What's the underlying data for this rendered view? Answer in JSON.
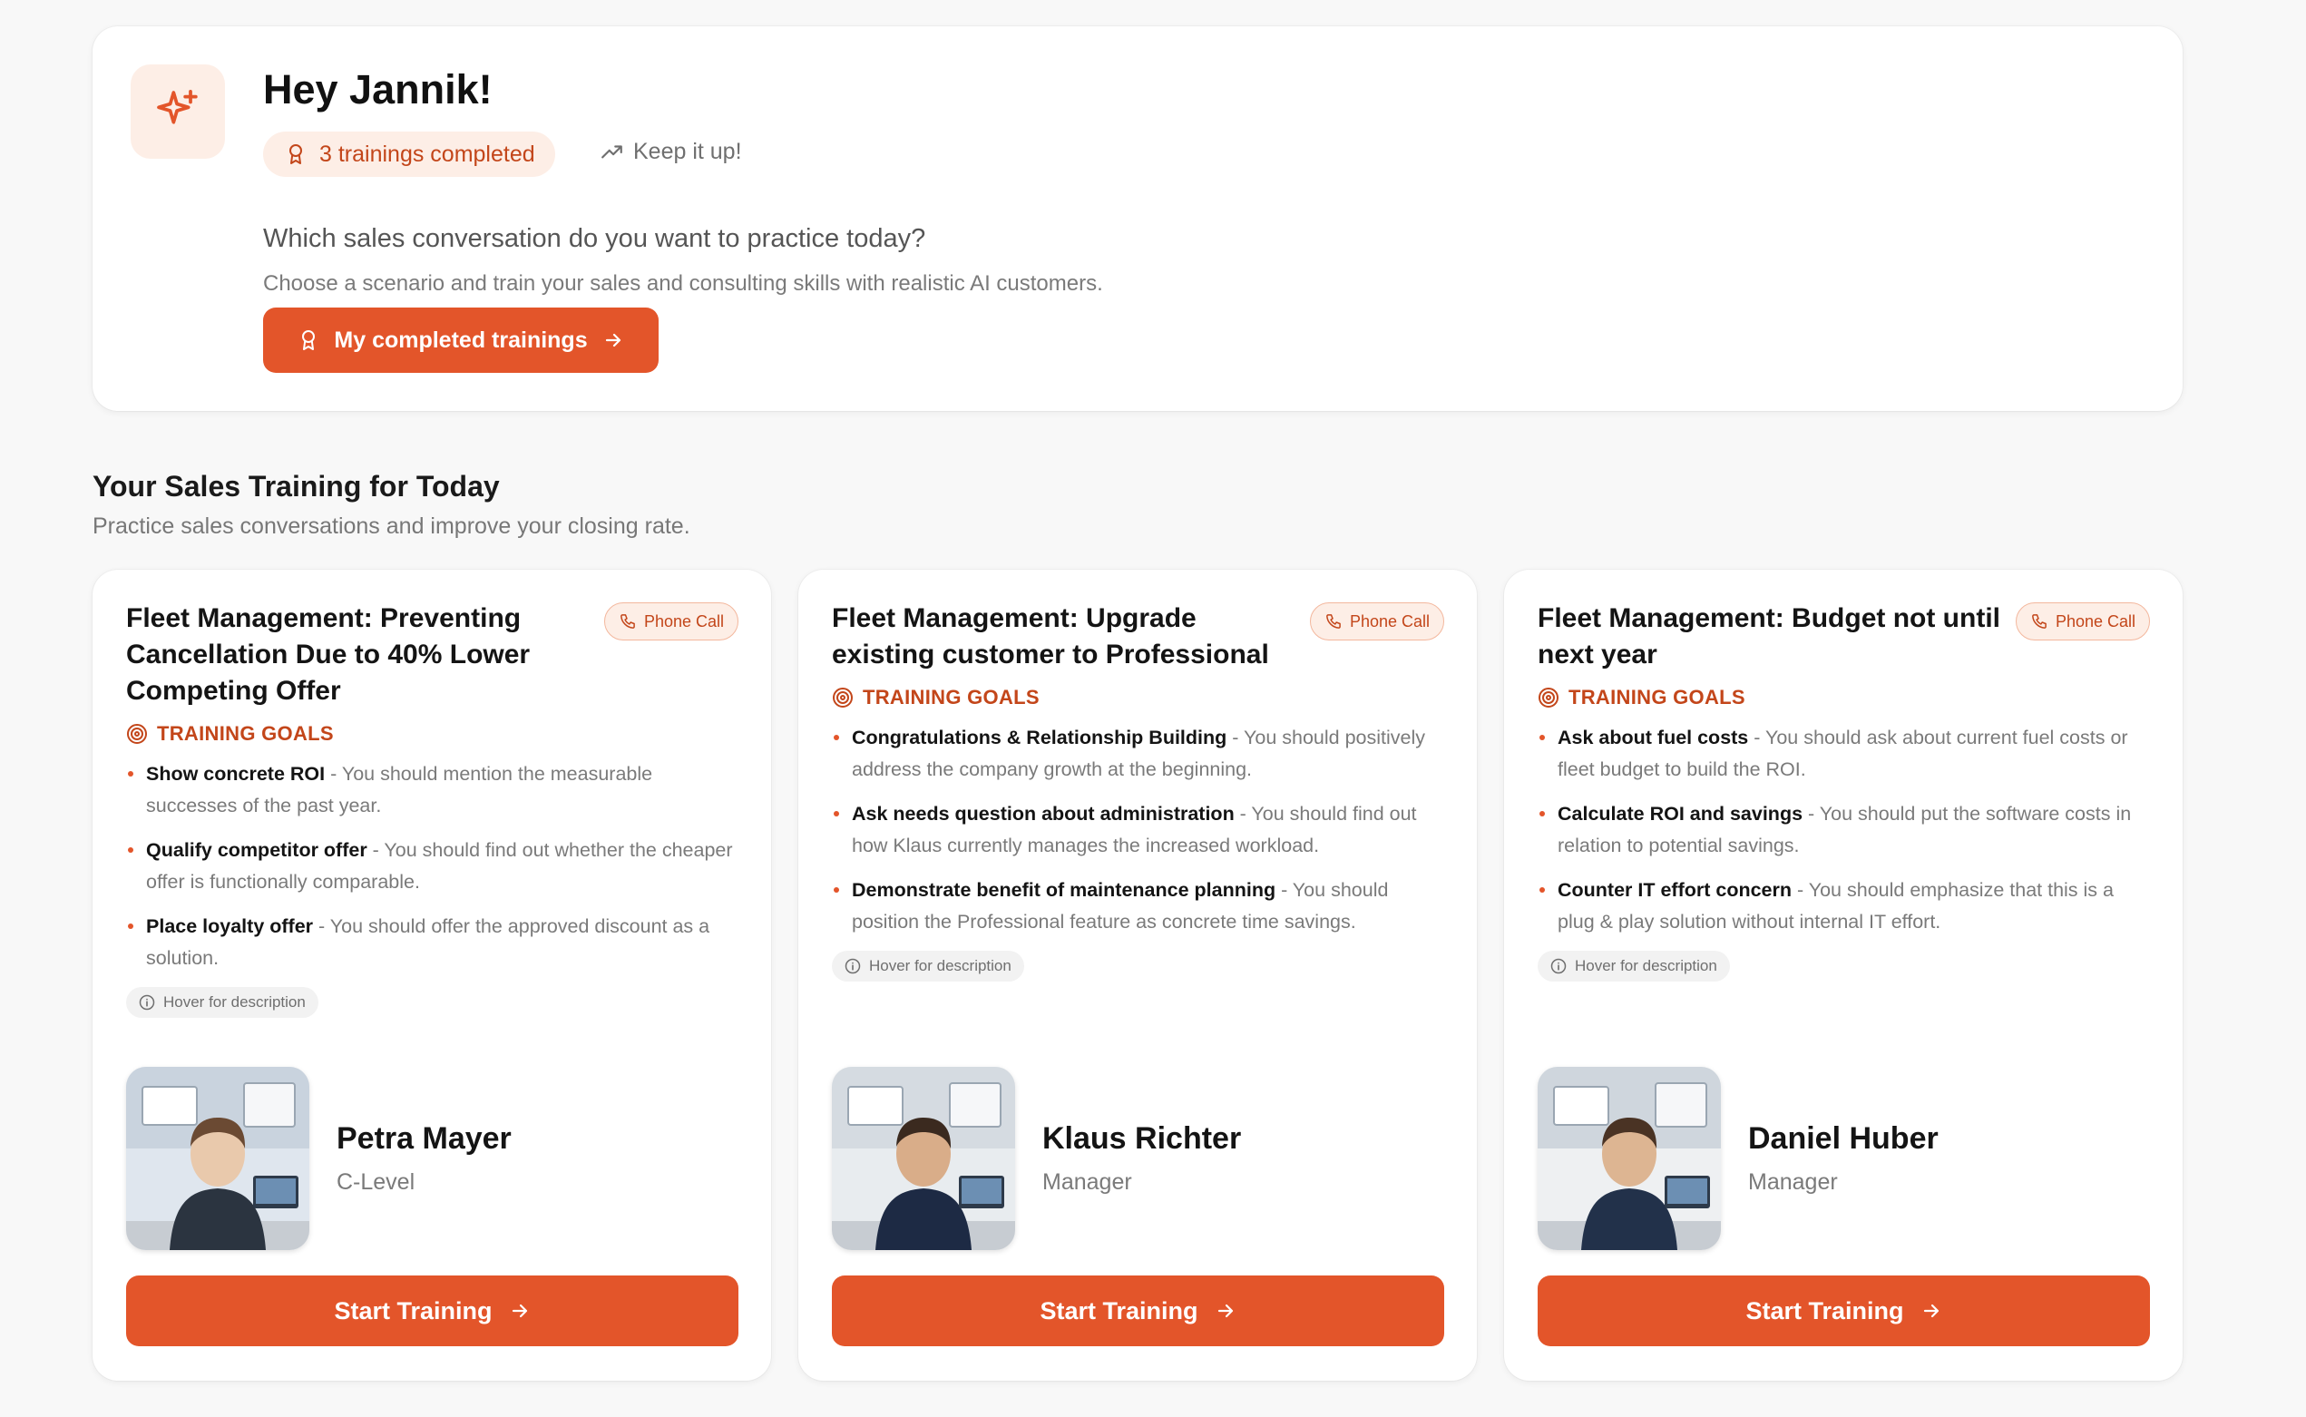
{
  "colors": {
    "accent": "#e3552a",
    "accent_dark": "#c3461a",
    "accent_light": "#fdeee6",
    "background": "#f8f8f8"
  },
  "hero": {
    "icon": "sparkles-icon",
    "title": "Hey Jannik!",
    "badge": {
      "icon": "award-icon",
      "label": "3 trainings completed"
    },
    "motivation": {
      "icon": "trending-up-icon",
      "label": "Keep it up!"
    },
    "question": "Which sales conversation do you want to practice today?",
    "subtitle": "Choose a scenario and train your sales and consulting skills with realistic AI customers.",
    "button": {
      "icon": "award-icon",
      "label": "My completed trainings",
      "trailing_icon": "arrow-right-icon"
    }
  },
  "section": {
    "title": "Your Sales Training for Today",
    "subtitle": "Practice sales conversations and improve your closing rate."
  },
  "cards": [
    {
      "title": "Fleet Management: Preventing Cancellation Due to 40% Lower Competing Offer",
      "badge": "Phone Call",
      "goals_label": "TRAINING GOALS",
      "goals": [
        {
          "title": "Show concrete ROI",
          "desc": " - You should mention the measurable successes of the past year."
        },
        {
          "title": "Qualify competitor offer",
          "desc": " - You should find out whether the cheaper offer is functionally comparable."
        },
        {
          "title": "Place loyalty offer",
          "desc": " - You should offer the approved discount as a solution."
        }
      ],
      "hint": "Hover for description",
      "persona": {
        "name": "Petra Mayer",
        "role": "C-Level"
      },
      "button": "Start Training"
    },
    {
      "title": "Fleet Management: Upgrade existing customer to Professional",
      "badge": "Phone Call",
      "goals_label": "TRAINING GOALS",
      "goals": [
        {
          "title": "Congratulations & Relationship Building",
          "desc": " - You should positively address the company growth at the beginning."
        },
        {
          "title": "Ask needs question about administration",
          "desc": " - You should find out how Klaus currently manages the increased workload."
        },
        {
          "title": "Demonstrate benefit of maintenance planning",
          "desc": " - You should position the Professional feature as concrete time savings."
        }
      ],
      "hint": "Hover for description",
      "persona": {
        "name": "Klaus Richter",
        "role": "Manager"
      },
      "button": "Start Training"
    },
    {
      "title": "Fleet Management: Budget not until next year",
      "badge": "Phone Call",
      "goals_label": "TRAINING GOALS",
      "goals": [
        {
          "title": "Ask about fuel costs",
          "desc": " - You should ask about current fuel costs or fleet budget to build the ROI."
        },
        {
          "title": "Calculate ROI and savings",
          "desc": " - You should put the software costs in relation to potential savings."
        },
        {
          "title": "Counter IT effort concern",
          "desc": " - You should emphasize that this is a plug & play solution without internal IT effort."
        }
      ],
      "hint": "Hover for description",
      "persona": {
        "name": "Daniel Huber",
        "role": "Manager"
      },
      "button": "Start Training"
    }
  ]
}
